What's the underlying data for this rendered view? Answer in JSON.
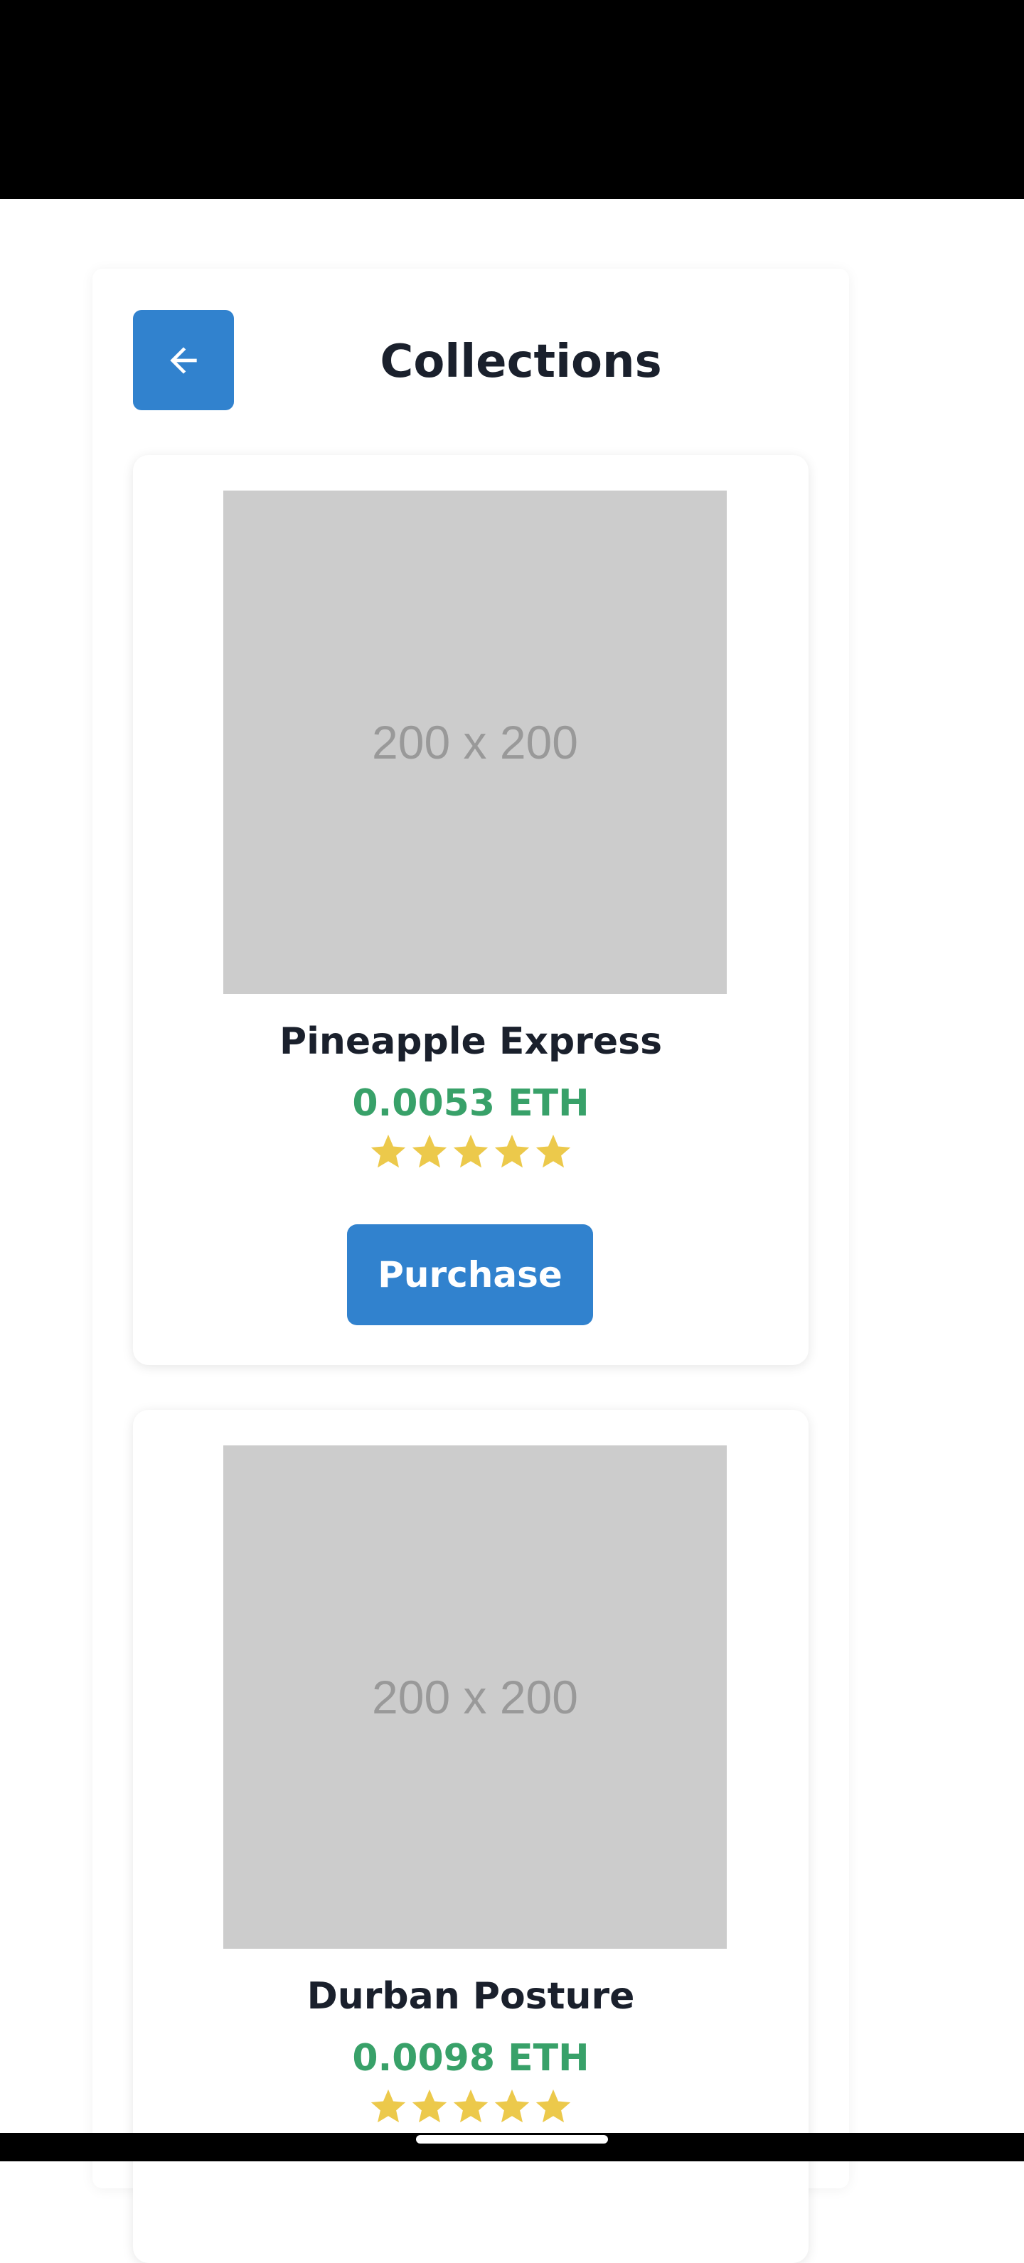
{
  "header": {
    "title": "Collections",
    "back_icon": "arrow-left-icon"
  },
  "products": [
    {
      "image_label": "200 x 200",
      "name": "Pineapple Express",
      "price": "0.0053 ETH",
      "rating": 5,
      "rating_max": 5,
      "button_label": "Purchase"
    },
    {
      "image_label": "200 x 200",
      "name": "Durban Posture",
      "price": "0.0098 ETH",
      "rating": 5,
      "rating_max": 5
    }
  ],
  "colors": {
    "accent": "#3182ce",
    "price": "#38a169",
    "star": "#ecc94b",
    "placeholder": "#cccccc"
  }
}
